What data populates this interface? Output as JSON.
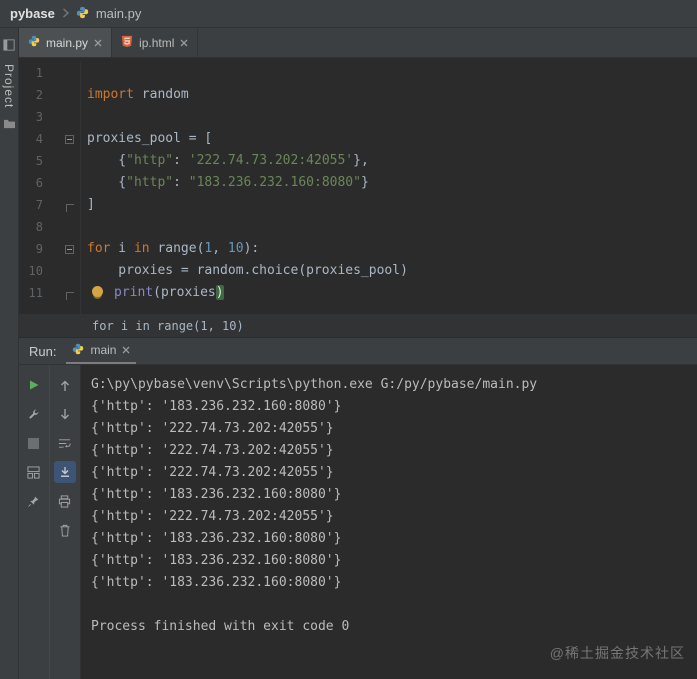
{
  "breadcrumb": {
    "project": "pybase",
    "file": "main.py"
  },
  "project_stripe": {
    "label": "Project"
  },
  "tabs": [
    {
      "label": "main.py",
      "active": true
    },
    {
      "label": "ip.html",
      "active": false
    }
  ],
  "editor": {
    "lines": [
      {
        "segments": []
      },
      {
        "segments": [
          [
            "import",
            "kw"
          ],
          [
            " random",
            "plain"
          ]
        ]
      },
      {
        "segments": []
      },
      {
        "fold": "start",
        "segments": [
          [
            "proxies_pool = [",
            "plain"
          ]
        ]
      },
      {
        "segments": [
          [
            "    {",
            "plain"
          ],
          [
            "\"http\"",
            "str"
          ],
          [
            ": ",
            "plain"
          ],
          [
            "'222.74.73.202:42055'",
            "str"
          ],
          [
            "},",
            "plain"
          ]
        ]
      },
      {
        "segments": [
          [
            "    {",
            "plain"
          ],
          [
            "\"http\"",
            "str"
          ],
          [
            ": ",
            "plain"
          ],
          [
            "\"183.236.232.160:8080\"",
            "str"
          ],
          [
            "}",
            "plain"
          ]
        ]
      },
      {
        "fold": "end",
        "segments": [
          [
            "]",
            "plain"
          ]
        ]
      },
      {
        "segments": []
      },
      {
        "fold": "start",
        "segments": [
          [
            "for",
            "kw"
          ],
          [
            " i ",
            "plain"
          ],
          [
            "in",
            "kw"
          ],
          [
            " range(",
            "plain"
          ],
          [
            "1",
            "num"
          ],
          [
            ", ",
            "plain"
          ],
          [
            "10",
            "num"
          ],
          [
            "):",
            "plain"
          ]
        ]
      },
      {
        "segments": [
          [
            "    proxies = random.choice(proxies_pool)",
            "plain"
          ]
        ]
      },
      {
        "fold": "end",
        "bulb": true,
        "segments": [
          [
            "print",
            "builtin"
          ],
          [
            "(proxies",
            "plain"
          ],
          [
            ")",
            "hl"
          ]
        ]
      }
    ],
    "context_line": "for i in range(1, 10)"
  },
  "run": {
    "label": "Run:",
    "tab_label": "main",
    "console": [
      "G:\\py\\pybase\\venv\\Scripts\\python.exe G:/py/pybase/main.py",
      "{'http': '183.236.232.160:8080'}",
      "{'http': '222.74.73.202:42055'}",
      "{'http': '222.74.73.202:42055'}",
      "{'http': '222.74.73.202:42055'}",
      "{'http': '183.236.232.160:8080'}",
      "{'http': '222.74.73.202:42055'}",
      "{'http': '183.236.232.160:8080'}",
      "{'http': '183.236.232.160:8080'}",
      "{'http': '183.236.232.160:8080'}",
      "",
      "Process finished with exit code 0"
    ]
  },
  "colors": {
    "keyword": "#cc7832",
    "string": "#6a8759",
    "number": "#6897bb",
    "builtin": "#8888c6",
    "editor_bg": "#2b2b2b",
    "panel_bg": "#3c3f41",
    "run_green": "#5caf5f"
  },
  "watermark": "@稀土掘金技术社区"
}
